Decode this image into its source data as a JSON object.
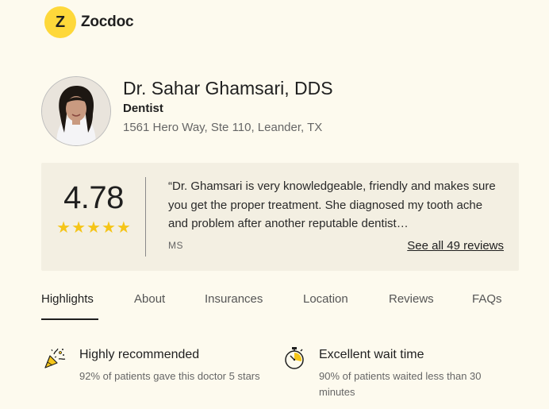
{
  "brand": {
    "logo_letter": "Z",
    "name": "Zocdoc",
    "accent": "#fed83a"
  },
  "doctor": {
    "name": "Dr. Sahar Ghamsari, DDS",
    "specialty": "Dentist",
    "address": "1561 Hero Way, Ste 110, Leander, TX",
    "avatar": "doctor-photo"
  },
  "review_summary": {
    "rating": "4.78",
    "stars": 5,
    "star_color": "#f5c518",
    "quote": "“Dr. Ghamsari is very knowledgeable, friendly and makes sure you get the proper treatment. She diagnosed my tooth ache and problem after another reputable dentist…",
    "reviewer": "MS",
    "see_all_label": "See all 49 reviews"
  },
  "tabs": [
    {
      "label": "Highlights",
      "active": true
    },
    {
      "label": "About"
    },
    {
      "label": "Insurances"
    },
    {
      "label": "Location"
    },
    {
      "label": "Reviews"
    },
    {
      "label": "FAQs"
    }
  ],
  "highlights": [
    {
      "icon": "party-popper-icon",
      "title": "Highly recommended",
      "subtitle": "92% of patients gave this doctor 5 stars"
    },
    {
      "icon": "stopwatch-icon",
      "title": "Excellent wait time",
      "subtitle": "90% of patients waited less than 30 minutes"
    }
  ]
}
